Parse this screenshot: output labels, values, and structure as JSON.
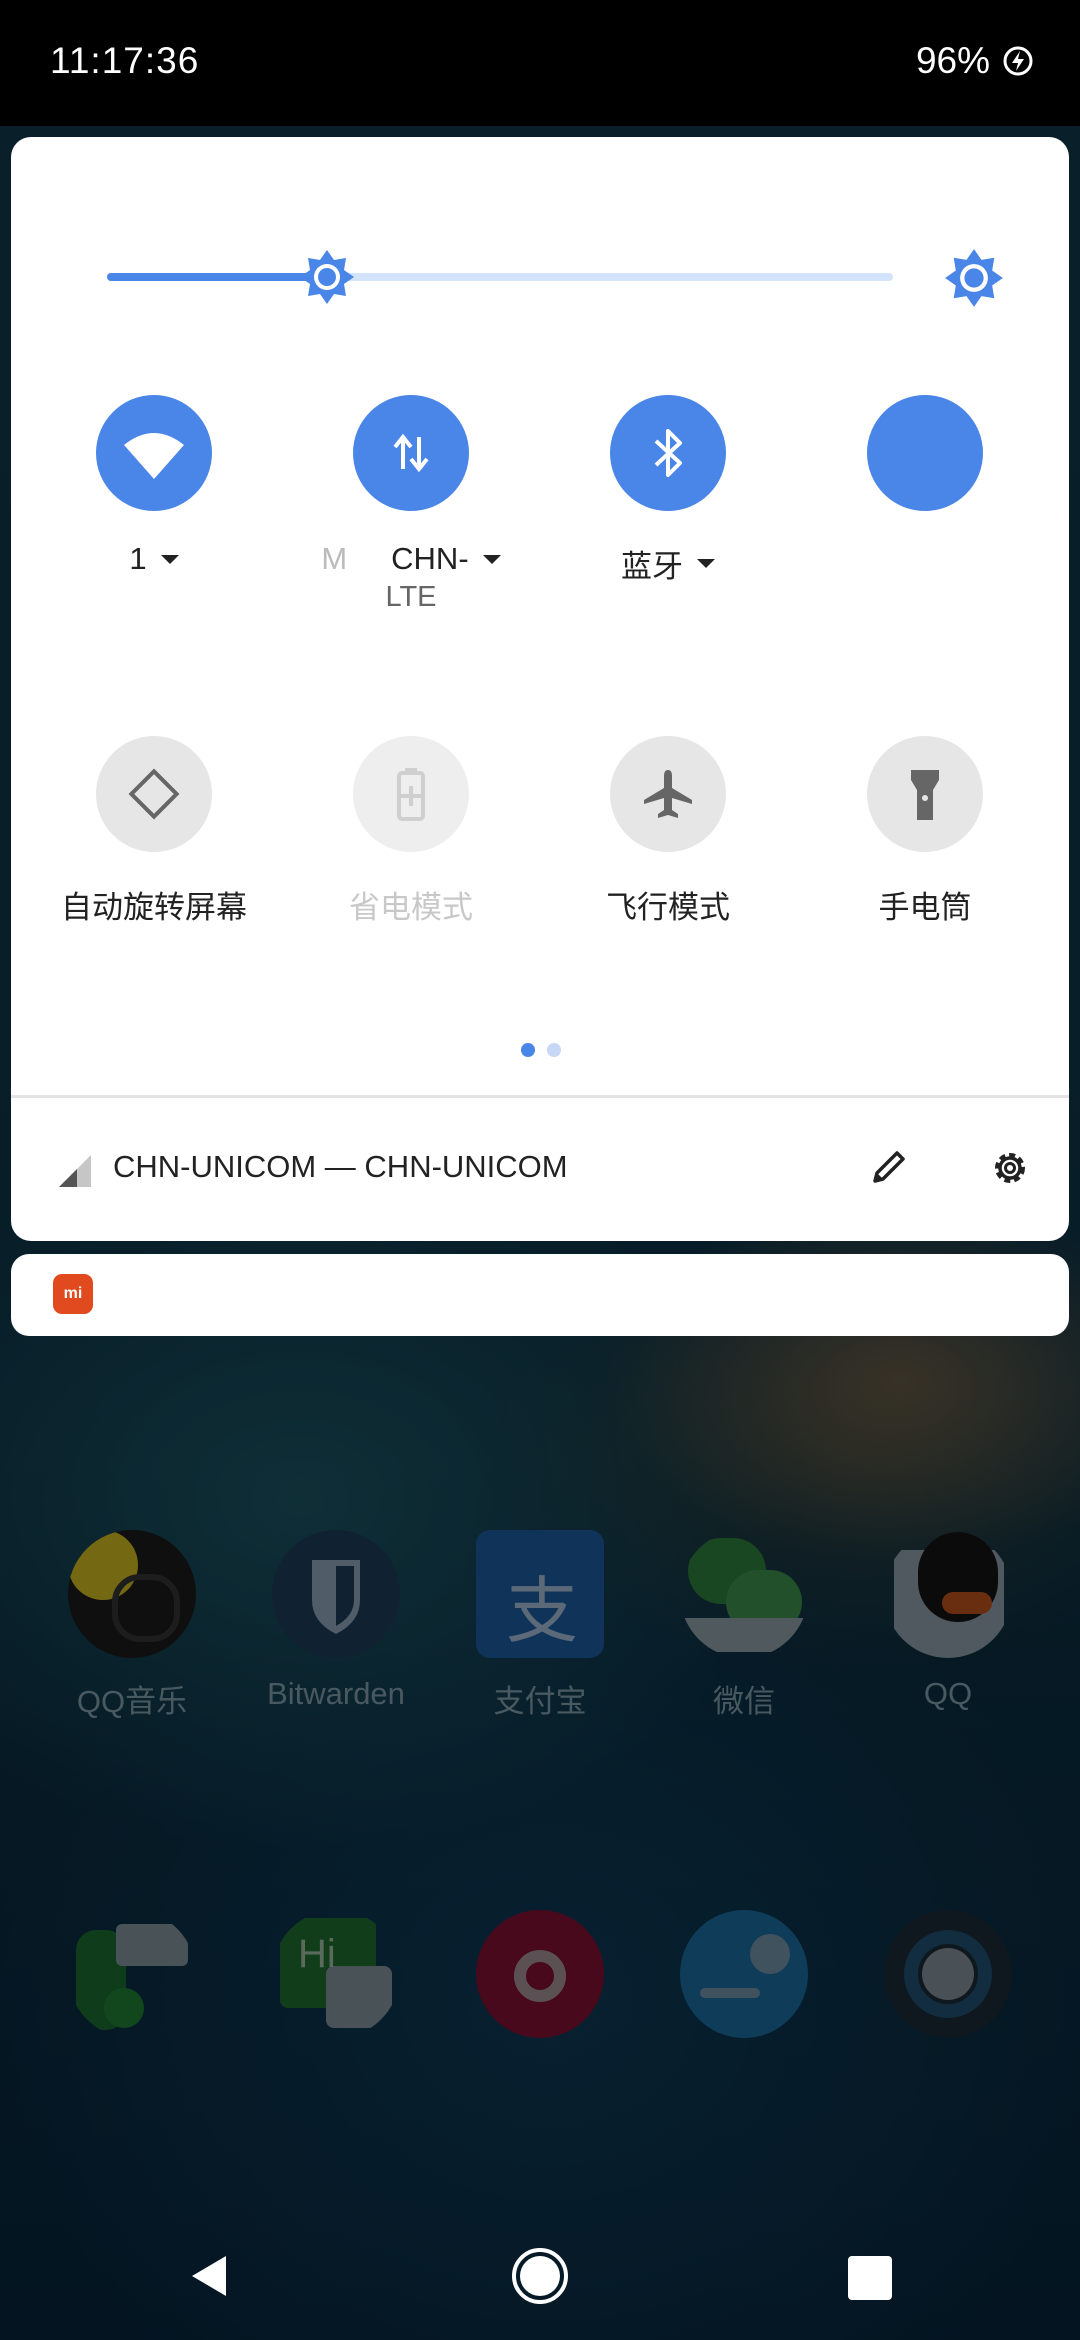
{
  "status_bar": {
    "time": "11:17:36",
    "battery": "96%"
  },
  "brightness": {
    "level": 0.28
  },
  "tiles_row1": [
    {
      "id": "wifi",
      "label": "1",
      "icon": "wifi-icon",
      "active": true
    },
    {
      "id": "mobile-data",
      "label_left": "M",
      "label": "CHN-",
      "sub": "LTE",
      "icon": "data-arrows-icon",
      "active": true
    },
    {
      "id": "bluetooth",
      "label": "蓝牙",
      "icon": "bluetooth-icon",
      "active": true
    },
    {
      "id": "blank",
      "label": "",
      "icon": "",
      "active": true
    }
  ],
  "tiles_row2": [
    {
      "id": "auto-rotate",
      "label": "自动旋转屏幕",
      "icon": "rotate-icon",
      "enabled": true
    },
    {
      "id": "battery-saver",
      "label": "省电模式",
      "icon": "battery-saver-icon",
      "enabled": false
    },
    {
      "id": "airplane",
      "label": "飞行模式",
      "icon": "airplane-icon",
      "enabled": true
    },
    {
      "id": "flashlight",
      "label": "手电筒",
      "icon": "flashlight-icon",
      "enabled": true
    }
  ],
  "footer": {
    "carrier": "CHN-UNICOM — CHN-UNICOM"
  },
  "notification": {
    "app_icon_text": "mi"
  },
  "apps_row1": [
    {
      "label": "QQ音乐",
      "color": "#1f1f1f"
    },
    {
      "label": "Bitwarden",
      "color": "#1d3b56"
    },
    {
      "label": "支付宝",
      "color": "#1c5a9a"
    },
    {
      "label": "微信",
      "color": "#2b7a3a"
    },
    {
      "label": "QQ",
      "color": "#183454"
    }
  ],
  "apps_row2": [
    {
      "name": "phone-messages",
      "color": "#1b5e2a"
    },
    {
      "name": "hangouts",
      "color": "#1e5a2c"
    },
    {
      "name": "music",
      "color": "#7a1030"
    },
    {
      "name": "app-blue",
      "color": "#1b6a9a"
    },
    {
      "name": "app-ring",
      "color": "#1a2a35"
    }
  ]
}
